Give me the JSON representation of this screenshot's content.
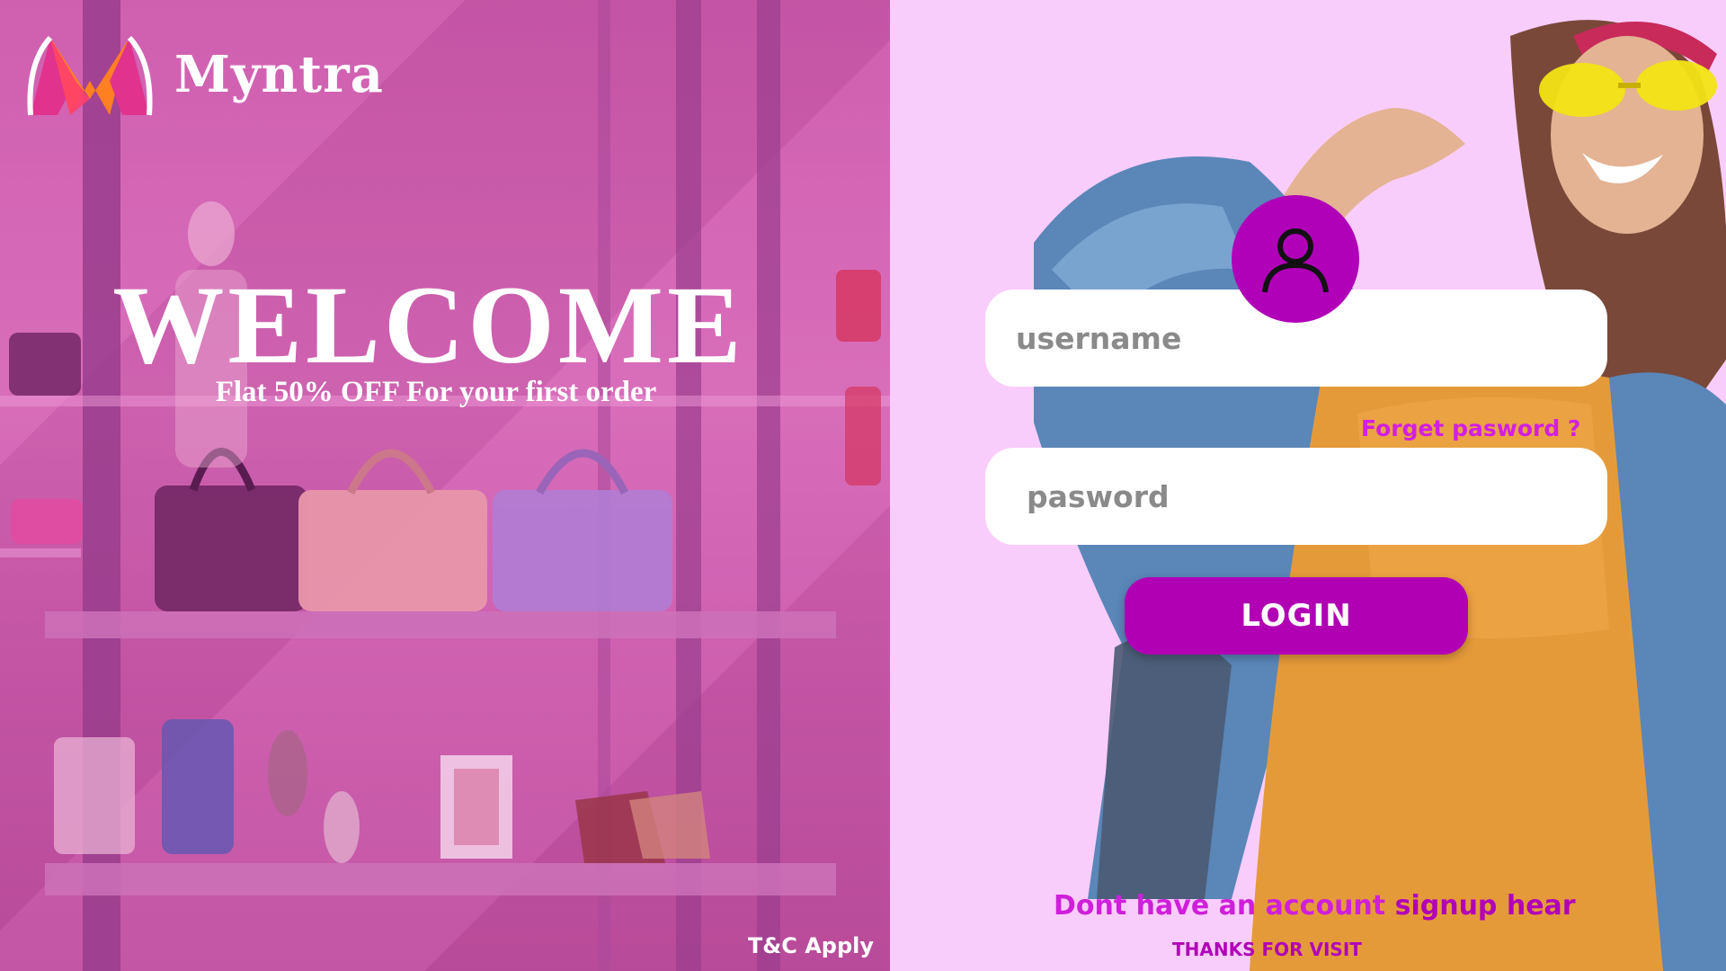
{
  "brand": {
    "name": "Myntra",
    "logo_icon": "myntra-m-logo",
    "logo_colors": [
      "#ff3f6c",
      "#ff7f23",
      "#e1338d"
    ]
  },
  "hero": {
    "headline": "WELCOME",
    "offer": "Flat 50% OFF For your first order",
    "terms": "T&C Apply"
  },
  "login_form": {
    "avatar_icon": "user-icon",
    "username_placeholder": "username",
    "password_placeholder": "pasword",
    "forgot_password": "Forget pasword ?",
    "login_label": "LOGIN",
    "signup_prompt": "Dont have an account",
    "signup_link": "signup hear",
    "thanks": "THANKS FOR VISIT"
  },
  "colors": {
    "page_background": "#f9cdfb",
    "accent_purple": "#b000b8",
    "link_magenta": "#d21fe0",
    "overlay_pink": "#d46cb6"
  }
}
